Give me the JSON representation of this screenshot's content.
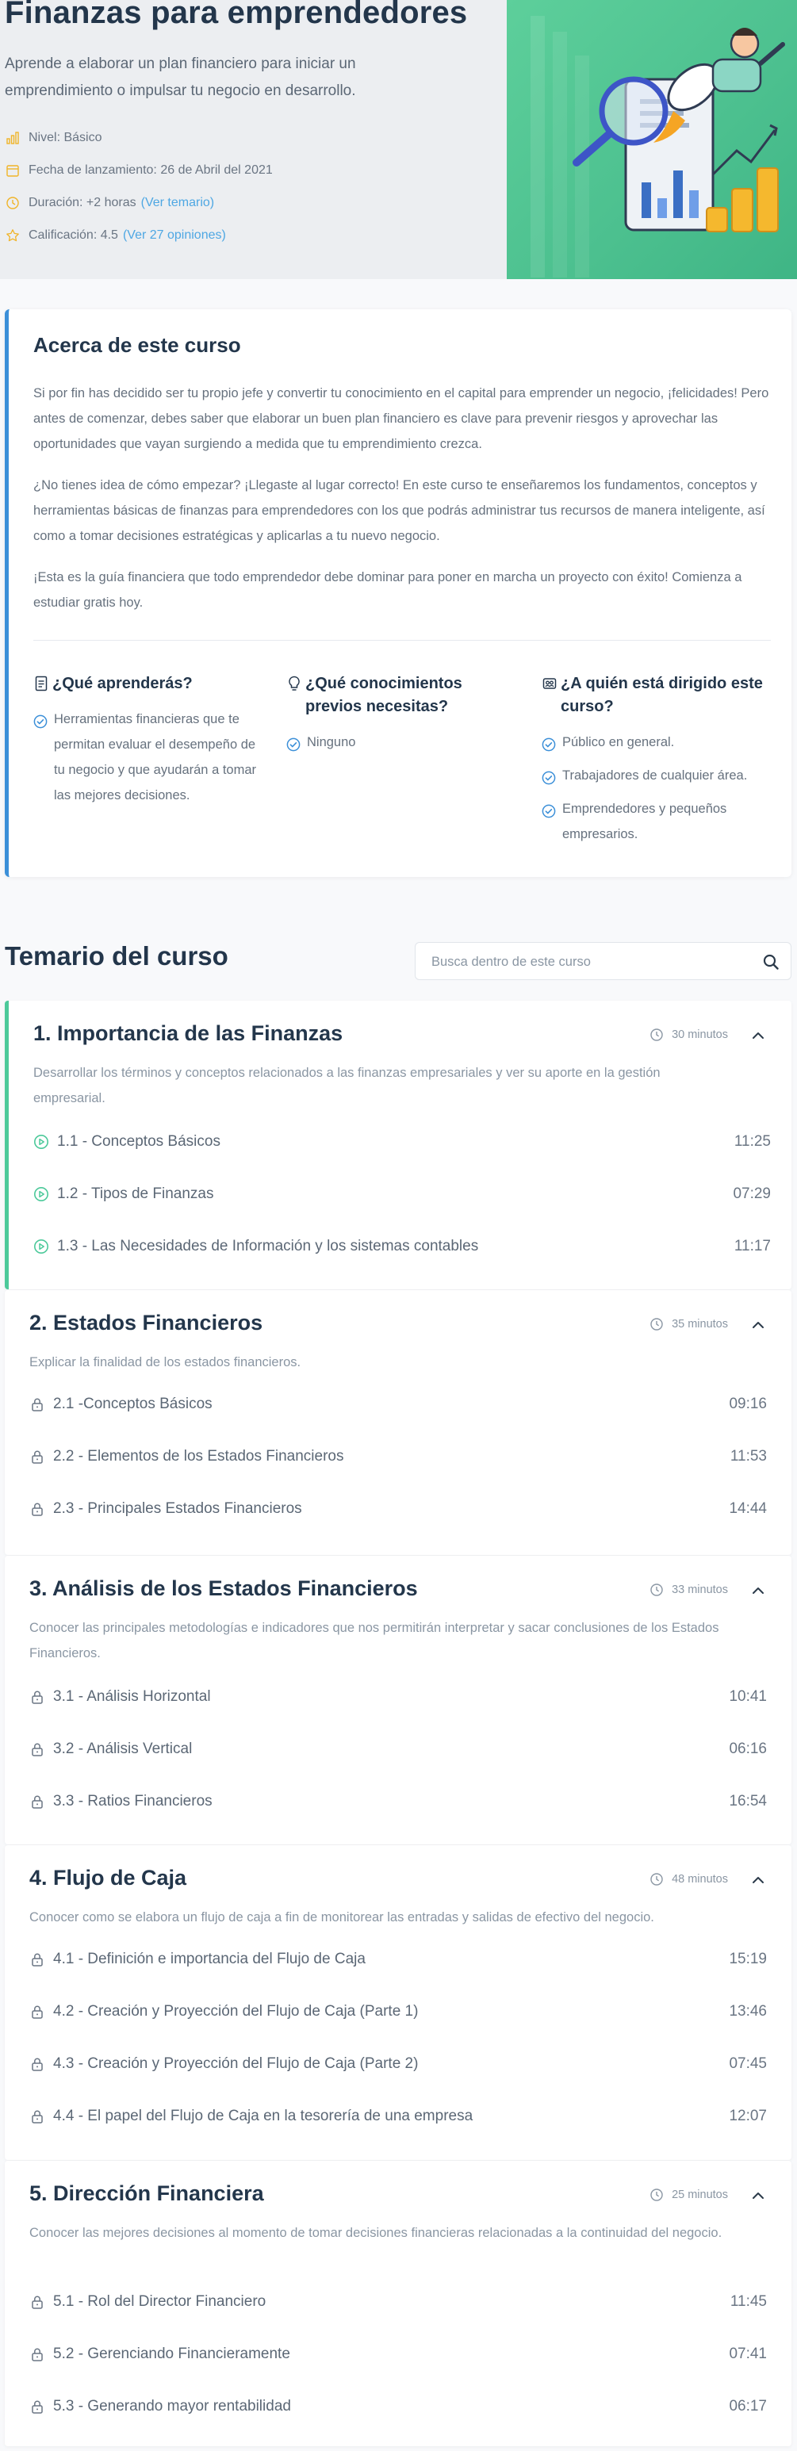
{
  "colors": {
    "accent": "#3b8fd8",
    "green": "#4cc99a",
    "link": "#4ea7e3",
    "heading": "#23364b",
    "muted": "#8a96a3",
    "star": "#f0b429"
  },
  "hero": {
    "title": "Finanzas para emprendedores",
    "subtitle": "Aprende a elaborar un plan financiero para iniciar un emprendimiento o impulsar tu negocio en desarrollo.",
    "level": "Nivel: Básico",
    "launch": "Fecha de lanzamiento: 26 de Abril del 2021",
    "duration": "Duración: +2 horas",
    "duration_link": "(Ver temario)",
    "rating": "Calificación: 4.5",
    "rating_link": "(Ver 27 opiniones)"
  },
  "about": {
    "title": "Acerca de este curso",
    "p1": "Si por fin has decidido ser tu propio jefe y convertir tu conocimiento en el capital para emprender un negocio, ¡felicidades! Pero antes de comenzar, debes saber que elaborar un buen plan financiero es clave para prevenir riesgos y aprovechar las oportunidades que vayan surgiendo a medida que tu emprendimiento crezca.",
    "p2": "¿No tienes idea de cómo empezar? ¡Llegaste al lugar correcto! En este curso te enseñaremos los fundamentos, conceptos y herramientas básicas de finanzas para emprendedores con los que podrás administrar tus recursos de manera inteligente, así como a tomar decisiones estratégicas y aplicarlas a tu nuevo negocio.",
    "p3": "¡Esta es la guía financiera que todo emprendedor debe dominar para poner en marcha un proyecto con éxito! Comienza a estudiar gratis hoy.",
    "learn": {
      "title": "¿Qué aprenderás?",
      "items": [
        "Herramientas financieras que te permitan evaluar el desempeño de tu negocio y que ayudarán a tomar las mejores decisiones."
      ]
    },
    "prereq": {
      "title": "¿Qué conocimientos previos necesitas?",
      "items": [
        "Ninguno"
      ]
    },
    "audience": {
      "title": "¿A quién está dirigido este curso?",
      "items": [
        "Público en general.",
        "Trabajadores de cualquier área.",
        "Emprendedores y pequeños empresarios."
      ]
    }
  },
  "syllabus": {
    "title": "Temario del curso",
    "search_placeholder": "Busca dentro de este curso",
    "modules": [
      {
        "title": "1. Importancia de las Finanzas",
        "duration": "30 minutos",
        "description": "Desarrollar los términos y conceptos relacionados a las finanzas empresariales y ver su aporte en la gestión empresarial.",
        "lessons": [
          {
            "name": "1.1 - Conceptos Básicos",
            "time": "11:25",
            "icon": "play-icon"
          },
          {
            "name": "1.2 - Tipos de Finanzas",
            "time": "07:29",
            "icon": "play-icon"
          },
          {
            "name": "1.3 - Las Necesidades de Información y los sistemas contables",
            "time": "11:17",
            "icon": "play-icon"
          }
        ]
      },
      {
        "title": "2. Estados Financieros",
        "duration": "35 minutos",
        "description": "Explicar la finalidad de los estados financieros.",
        "lessons": [
          {
            "name": "2.1 -Conceptos Básicos",
            "time": "09:16",
            "icon": "lock-icon"
          },
          {
            "name": "2.2 - Elementos de los Estados Financieros",
            "time": "11:53",
            "icon": "lock-icon"
          },
          {
            "name": "2.3 - Principales Estados Financieros",
            "time": "14:44",
            "icon": "lock-icon"
          }
        ]
      },
      {
        "title": "3. Análisis de los Estados Financieros",
        "duration": "33 minutos",
        "description": "Conocer las principales metodologías e indicadores que nos permitirán interpretar y sacar conclusiones de los Estados Financieros.",
        "lessons": [
          {
            "name": "3.1 - Análisis Horizontal",
            "time": "10:41",
            "icon": "lock-icon"
          },
          {
            "name": "3.2 - Análisis Vertical",
            "time": "06:16",
            "icon": "lock-icon"
          },
          {
            "name": "3.3 - Ratios Financieros",
            "time": "16:54",
            "icon": "lock-icon"
          }
        ]
      },
      {
        "title": "4. Flujo de Caja",
        "duration": "48 minutos",
        "description": "Conocer como se elabora un flujo de caja a fin de monitorear las entradas y salidas de efectivo del negocio.",
        "lessons": [
          {
            "name": "4.1 - Definición e importancia del Flujo de Caja",
            "time": "15:19",
            "icon": "lock-icon"
          },
          {
            "name": "4.2 - Creación y Proyección del Flujo de Caja (Parte 1)",
            "time": "13:46",
            "icon": "lock-icon"
          },
          {
            "name": "4.3 - Creación y Proyección del Flujo de Caja (Parte 2)",
            "time": "07:45",
            "icon": "lock-icon"
          },
          {
            "name": "4.4 - El papel del Flujo de Caja en la tesorería de una empresa",
            "time": "12:07",
            "icon": "lock-icon"
          }
        ]
      },
      {
        "title": "5. Dirección Financiera",
        "duration": "25 minutos",
        "description": "Conocer las mejores decisiones al momento de tomar decisiones financieras relacionadas a la continuidad del negocio.",
        "lessons": [
          {
            "name": "5.1 - Rol del Director Financiero",
            "time": "11:45",
            "icon": "lock-icon"
          },
          {
            "name": "5.2 - Gerenciando Financieramente",
            "time": "07:41",
            "icon": "lock-icon"
          },
          {
            "name": "5.3 - Generando mayor rentabilidad",
            "time": "06:17",
            "icon": "lock-icon"
          }
        ]
      }
    ]
  }
}
